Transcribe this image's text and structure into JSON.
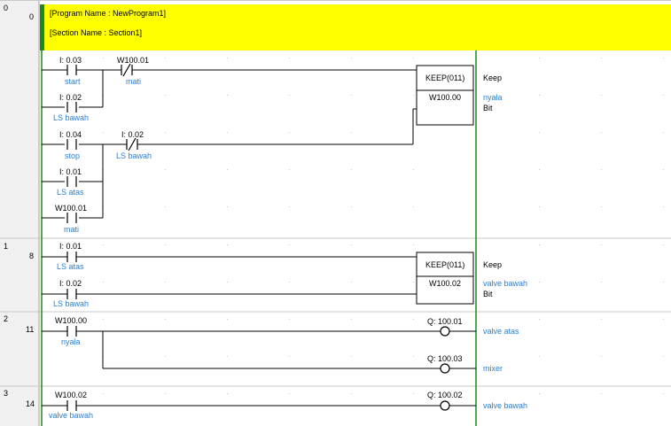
{
  "header": {
    "program_name": "[Program Name : NewProgram1]",
    "section_name": "[Section Name : Section1]"
  },
  "rungs": [
    {
      "index": "0",
      "step": "0",
      "contacts": [
        {
          "addr": "I: 0.03",
          "comment": "start",
          "type": "NO"
        },
        {
          "addr": "W100.01",
          "comment": "mati",
          "type": "NC"
        },
        {
          "addr": "I: 0.02",
          "comment": "LS bawah",
          "type": "NO"
        },
        {
          "addr": "I: 0.04",
          "comment": "stop",
          "type": "NO"
        },
        {
          "addr": "I: 0.02",
          "comment": "LS bawah",
          "type": "NC"
        },
        {
          "addr": "I: 0.01",
          "comment": "LS atas",
          "type": "NO"
        },
        {
          "addr": "W100.01",
          "comment": "mati",
          "type": "NO"
        }
      ],
      "block": {
        "name": "KEEP(011)",
        "operand": "W100.00",
        "label": "Keep",
        "operand_comment": "nyala",
        "operand_type": "Bit"
      }
    },
    {
      "index": "1",
      "step": "8",
      "contacts": [
        {
          "addr": "I: 0.01",
          "comment": "LS atas",
          "type": "NO"
        },
        {
          "addr": "I: 0.02",
          "comment": "LS bawah",
          "type": "NO"
        }
      ],
      "block": {
        "name": "KEEP(011)",
        "operand": "W100.02",
        "label": "Keep",
        "operand_comment": "valve bawah",
        "operand_type": "Bit"
      }
    },
    {
      "index": "2",
      "step": "11",
      "contacts": [
        {
          "addr": "W100.00",
          "comment": "nyala",
          "type": "NO"
        }
      ],
      "coils": [
        {
          "addr": "Q: 100.01",
          "comment": "valve atas"
        },
        {
          "addr": "Q: 100.03",
          "comment": "mixer"
        }
      ]
    },
    {
      "index": "3",
      "step": "14",
      "contacts": [
        {
          "addr": "W100.02",
          "comment": "valve bawah",
          "type": "NO"
        }
      ],
      "coils": [
        {
          "addr": "Q: 100.02",
          "comment": "valve bawah"
        }
      ]
    }
  ],
  "colors": {
    "header_bg": "#ffff00",
    "rung_index_bg": "#f0f0f0",
    "power_rail": "#1a8a1a",
    "comment_text": "#2a7fd4"
  }
}
